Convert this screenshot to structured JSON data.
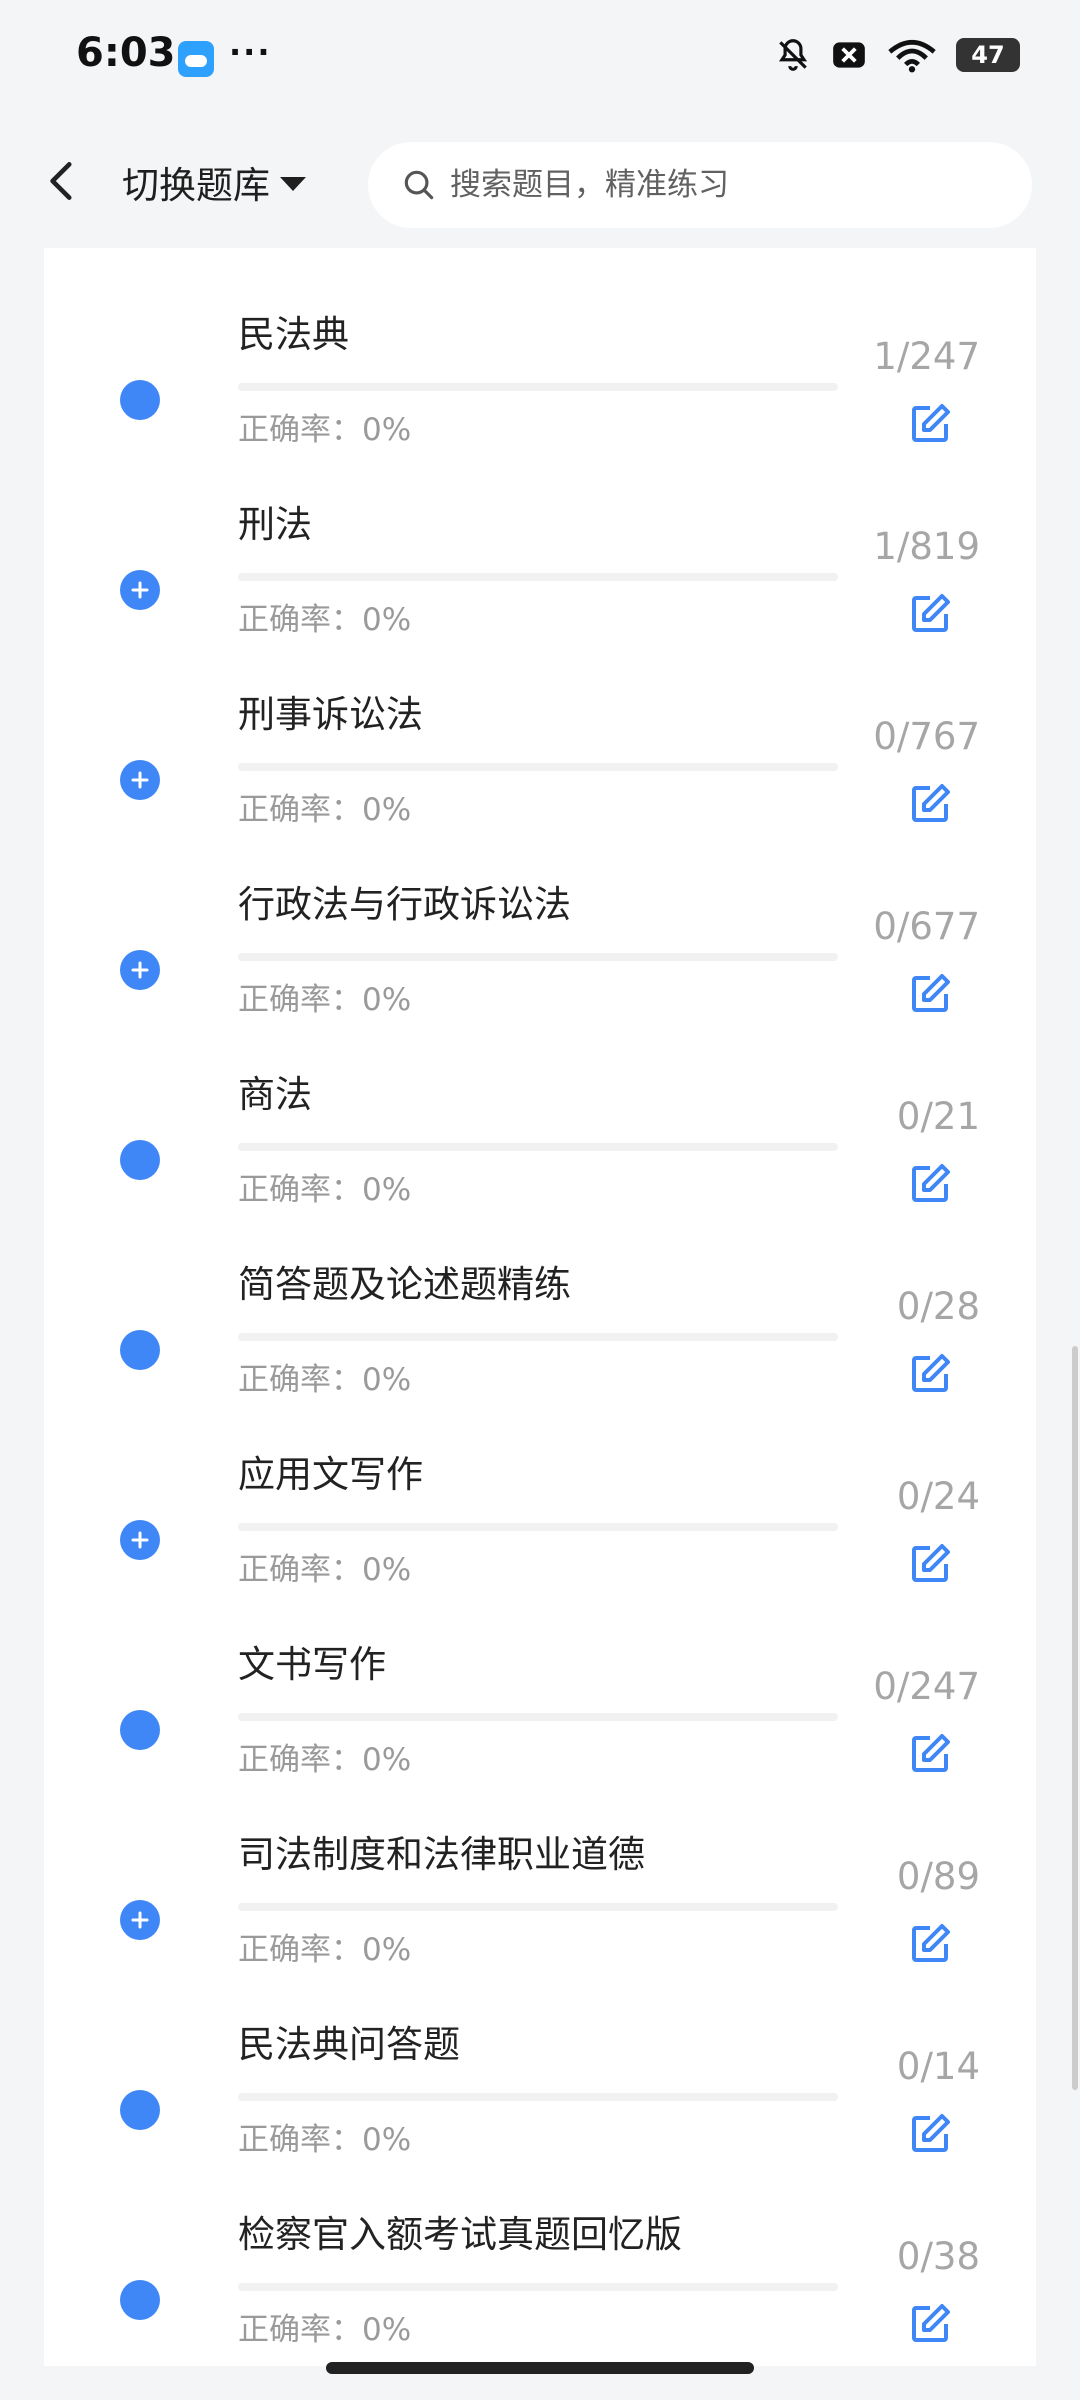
{
  "status_bar": {
    "time": "6:03",
    "dots": "···",
    "battery": "47",
    "icons": [
      "mute-bell-icon",
      "close-badge-icon",
      "wifi-icon"
    ]
  },
  "header": {
    "back_label": "",
    "switch_label": "切换题库",
    "search_placeholder": "搜索题目，精准练习"
  },
  "items": [
    {
      "title": "民法典",
      "accuracy": "正确率：0%",
      "count": "1/247",
      "bullet": "filled"
    },
    {
      "title": "刑法",
      "accuracy": "正确率：0%",
      "count": "1/819",
      "bullet": "plus"
    },
    {
      "title": "刑事诉讼法",
      "accuracy": "正确率：0%",
      "count": "0/767",
      "bullet": "plus"
    },
    {
      "title": "行政法与行政诉讼法",
      "accuracy": "正确率：0%",
      "count": "0/677",
      "bullet": "plus"
    },
    {
      "title": "商法",
      "accuracy": "正确率：0%",
      "count": "0/21",
      "bullet": "filled"
    },
    {
      "title": "简答题及论述题精练",
      "accuracy": "正确率：0%",
      "count": "0/28",
      "bullet": "filled"
    },
    {
      "title": "应用文写作",
      "accuracy": "正确率：0%",
      "count": "0/24",
      "bullet": "plus"
    },
    {
      "title": "文书写作",
      "accuracy": "正确率：0%",
      "count": "0/247",
      "bullet": "filled"
    },
    {
      "title": "司法制度和法律职业道德",
      "accuracy": "正确率：0%",
      "count": "0/89",
      "bullet": "plus"
    },
    {
      "title": "民法典问答题",
      "accuracy": "正确率：0%",
      "count": "0/14",
      "bullet": "filled"
    },
    {
      "title": "检察官入额考试真题回忆版",
      "accuracy": "正确率：0%",
      "count": "0/38",
      "bullet": "filled"
    }
  ],
  "colors": {
    "accent": "#3f86f7",
    "muted": "#a6a6a6",
    "background": "#f4f5f7"
  }
}
